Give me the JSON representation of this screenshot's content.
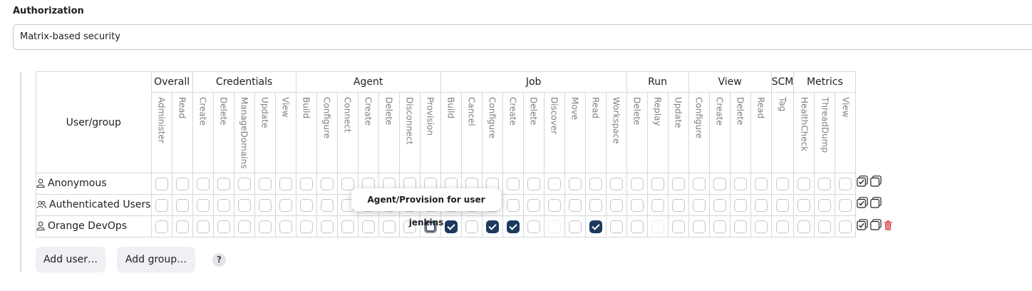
{
  "section_title": "Authorization",
  "strategy_value": "Matrix-based security",
  "user_group_header": "User/group",
  "groups": [
    {
      "name": "Overall",
      "span": 2
    },
    {
      "name": "Credentials",
      "span": 5
    },
    {
      "name": "Agent",
      "span": 7
    },
    {
      "name": "Job",
      "span": 9
    },
    {
      "name": "Run",
      "span": 3
    },
    {
      "name": "View",
      "span": 4
    },
    {
      "name": "SCM",
      "span": 1
    },
    {
      "name": "Metrics",
      "span": 3
    }
  ],
  "permissions": [
    "Administer",
    "Read",
    "Create",
    "Delete",
    "ManageDomains",
    "Update",
    "View",
    "Build",
    "Configure",
    "Connect",
    "Create",
    "Delete",
    "Disconnect",
    "Provision",
    "Build",
    "Cancel",
    "Configure",
    "Create",
    "Delete",
    "Discover",
    "Move",
    "Read",
    "Workspace",
    "Delete",
    "Replay",
    "Update",
    "Configure",
    "Create",
    "Delete",
    "Read",
    "Tag",
    "HealthCheck",
    "ThreadDump",
    "View"
  ],
  "rows": [
    {
      "name": "Anonymous",
      "icon": "user-icon",
      "checked": [],
      "deletable": false
    },
    {
      "name": "Authenticated Users",
      "icon": "users-icon",
      "checked": [],
      "deletable": false
    },
    {
      "name": "Orange DevOps",
      "icon": "user-icon",
      "checked": [
        14,
        16,
        17,
        21
      ],
      "focused": 13,
      "faded": [
        19,
        24
      ],
      "deletable": true
    }
  ],
  "tooltip": "Agent/Provision for user jenkins",
  "buttons": {
    "add_user": "Add user…",
    "add_group": "Add group…",
    "help": "?"
  },
  "colors": {
    "checked": "#1b3a5c",
    "border": "#c3c6cd",
    "delete": "#e0494f"
  }
}
